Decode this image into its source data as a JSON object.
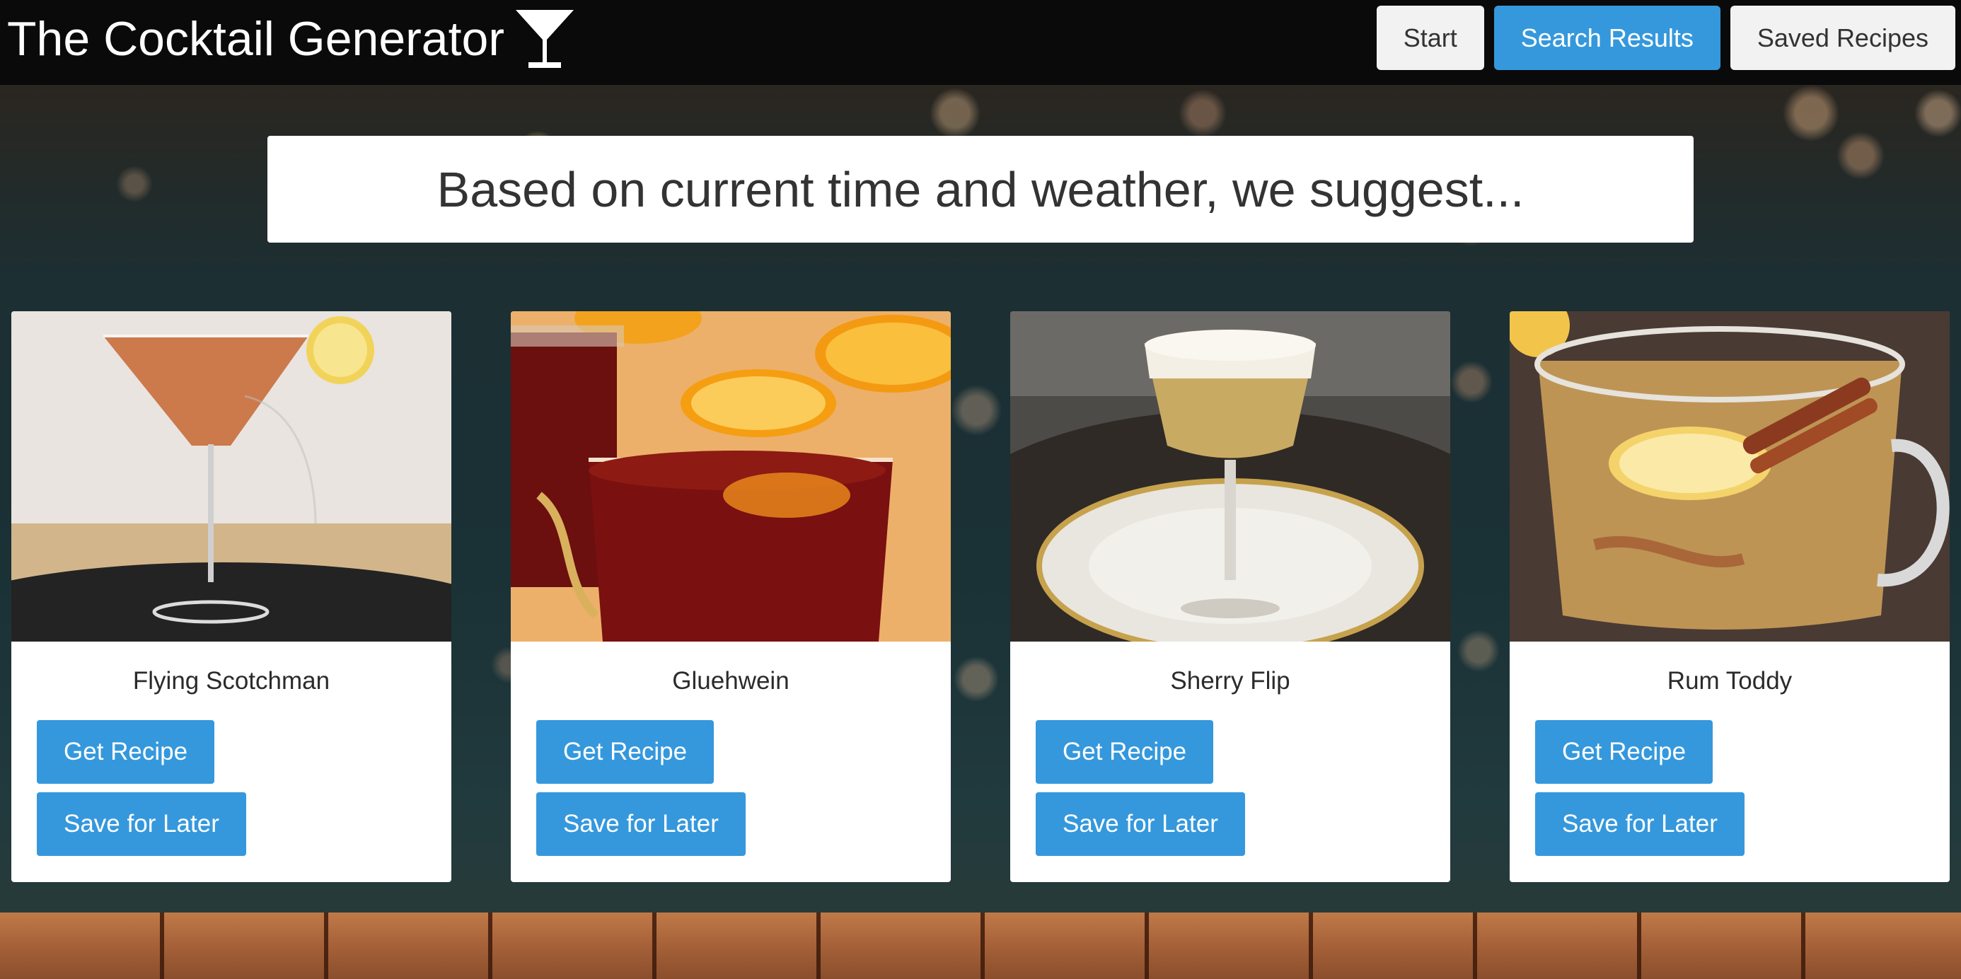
{
  "app": {
    "title": "The Cocktail Generator",
    "icon": "cocktail-glass-icon"
  },
  "nav": {
    "items": [
      {
        "label": "Start",
        "active": false
      },
      {
        "label": "Search Results",
        "active": true
      },
      {
        "label": "Saved Recipes",
        "active": false
      }
    ]
  },
  "banner": {
    "text": "Based on current time and weather, we suggest..."
  },
  "cards": [
    {
      "name": "Flying Scotchman",
      "image": "flying-scotchman-photo",
      "primary_action": "Get Recipe",
      "secondary_action": "Save for Later"
    },
    {
      "name": "Gluehwein",
      "image": "gluehwein-photo",
      "primary_action": "Get Recipe",
      "secondary_action": "Save for Later"
    },
    {
      "name": "Sherry Flip",
      "image": "sherry-flip-photo",
      "primary_action": "Get Recipe",
      "secondary_action": "Save for Later"
    },
    {
      "name": "Rum Toddy",
      "image": "rum-toddy-photo",
      "primary_action": "Get Recipe",
      "secondary_action": "Save for Later"
    }
  ],
  "colors": {
    "accent": "#3598dc",
    "header_bg": "#0a0a0a",
    "inactive_button": "#f2f2f2",
    "card_bg": "#ffffff"
  }
}
